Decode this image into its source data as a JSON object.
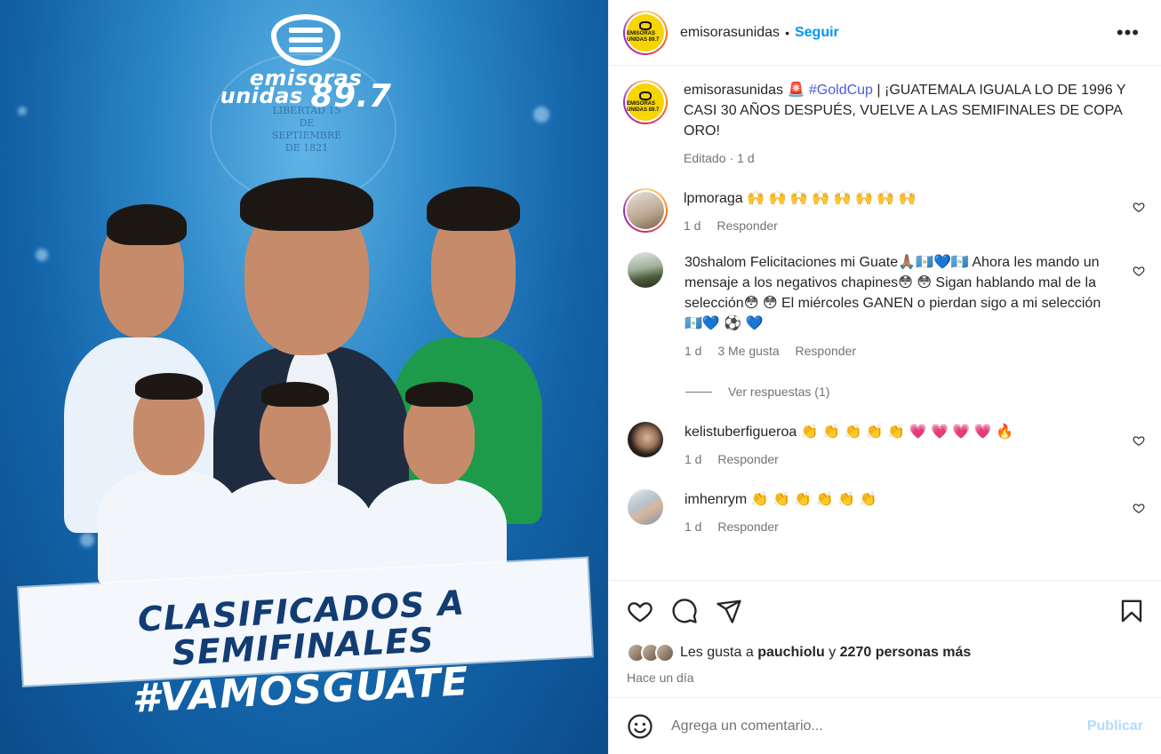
{
  "media": {
    "brand_line1": "emisoras",
    "brand_line2": "unidas",
    "brand_freq": "89.7",
    "seal_text": "LIBERTAD 15 DE SEPTIEMBRE DE 1821",
    "banner_line1": "CLASIFICADOS A",
    "banner_line2": "SEMIFINALES",
    "hashtag": "#VAMOSGUATE"
  },
  "header": {
    "username": "emisorasunidas",
    "separator": "•",
    "follow_label": "Seguir",
    "more_label": "•••",
    "avatar_text": "EMISORAS UNIDAS 89.7"
  },
  "caption": {
    "username": "emisorasunidas",
    "emoji": "🚨",
    "hashtag": "#GoldCup",
    "text": "| ¡GUATEMALA IGUALA LO DE 1996 Y CASI 30 AÑOS DESPUÉS, VUELVE A LAS SEMIFINALES DE COPA ORO!",
    "edited": "Editado",
    "time": "1 d"
  },
  "comments": [
    {
      "username": "lpmoraga",
      "text": "🙌 🙌 🙌 🙌 🙌 🙌 🙌 🙌",
      "time": "1 d",
      "likes": "",
      "reply_label": "Responder"
    },
    {
      "username": "30shalom",
      "text": "Felicitaciones mi Guate🙏🏽🇬🇹💙🇬🇹 Ahora les mando un mensaje a los negativos chapines😳 😳 Sigan hablando mal de la selección😳 😳 El miércoles GANEN o pierdan sigo a mi selección🇬🇹💙 ⚽ 💙",
      "time": "1 d",
      "likes": "3 Me gusta",
      "reply_label": "Responder",
      "view_replies": "Ver respuestas (1)"
    },
    {
      "username": "kelistuberfigueroa",
      "text": "👏 👏 👏 👏 👏 💗 💗 💗 💗 🔥",
      "time": "1 d",
      "likes": "",
      "reply_label": "Responder"
    },
    {
      "username": "imhenrym",
      "text": "👏 👏 👏 👏 👏 👏",
      "time": "1 d",
      "likes": "",
      "reply_label": "Responder"
    }
  ],
  "likes": {
    "prefix": "Les gusta a",
    "user": "pauchiolu",
    "connector": "y",
    "others": "2270 personas más"
  },
  "posted": "Hace un día",
  "add_comment": {
    "placeholder": "Agrega un comentario...",
    "post_label": "Publicar"
  },
  "icons": [
    "like-icon",
    "comment-icon",
    "share-icon",
    "bookmark-icon",
    "emoji-icon",
    "heart-icon"
  ],
  "colors": {
    "accent": "#0095f6",
    "hashtag": "#4a5be6",
    "muted": "#737373",
    "post_disabled": "#b3dbff",
    "media_blue": "#1363a8",
    "banner_text": "#123c73"
  }
}
